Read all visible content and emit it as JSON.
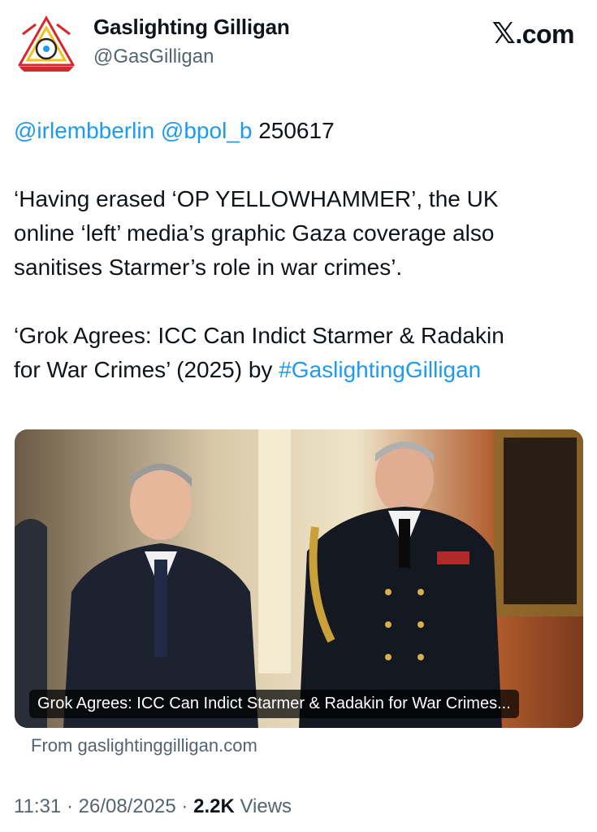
{
  "author": {
    "name": "Gaslighting Gilligan",
    "handle": "@GasGilligan"
  },
  "brand": {
    "logo_letter": "𝕏",
    "logo_text": ".com"
  },
  "tweet": {
    "mention1": "@irlembberlin",
    "mention2": "@bpol_b",
    "code": "250617",
    "para1_line1": "‘Having erased ‘OP YELLOWHAMMER’, the UK",
    "para1_line2": "online ‘left’ media’s graphic Gaza coverage also",
    "para1_line3": "sanitises Starmer’s role in war crimes’.",
    "para2_line1": "‘Grok Agrees: ICC Can Indict Starmer & Radakin",
    "para2_line2_text": "for War Crimes’ (2025) by ",
    "hashtag": "#GaslightingGilligan"
  },
  "card": {
    "caption": "Grok Agrees: ICC Can Indict Starmer & Radakin for War Crimes...",
    "source": "From gaslightinggilligan.com"
  },
  "meta": {
    "time": "11:31",
    "date": "26/08/2025",
    "views_count": "2.2K",
    "views_label": "Views"
  },
  "colors": {
    "link": "#1d9bf0",
    "secondary": "#536471",
    "text": "#0f1419"
  }
}
